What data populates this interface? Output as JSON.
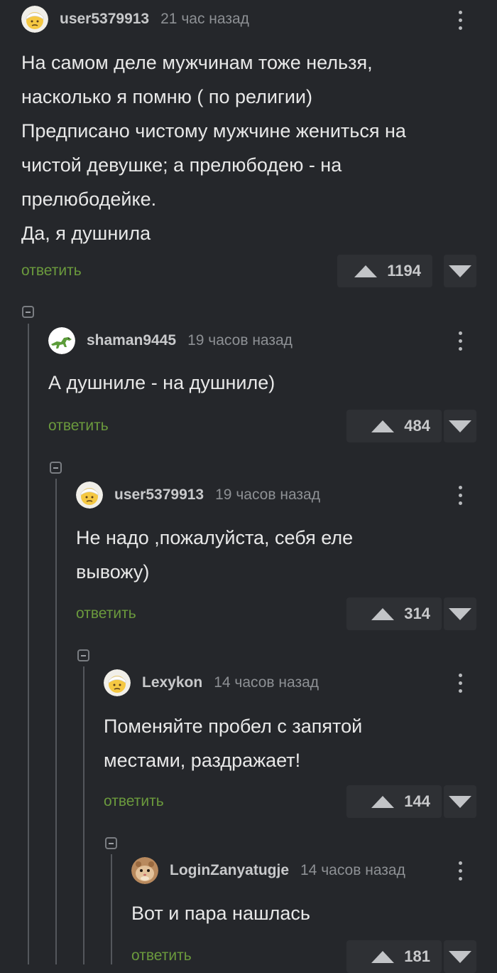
{
  "comments": [
    {
      "username": "user5379913",
      "time": "21 час назад",
      "text": "На самом деле мужчинам тоже нельзя,\nнасколько я помню ( по религии)\nПредписано чистому мужчине жениться на\nчистой девушке; а прелюбодею - на\nпрелюбодейке.\nДа, я душнила",
      "reply_label": "ответить",
      "rating": "1194",
      "avatar_icon": "face-with-head-bandage-emoji"
    },
    {
      "username": "shaman9445",
      "time": "19 часов назад",
      "text": "А душниле - на душниле)",
      "reply_label": "ответить",
      "rating": "484",
      "avatar_icon": "green-dinosaur-avatar"
    },
    {
      "username": "user5379913",
      "time": "19 часов назад",
      "text": "Не надо ,пожалуйста, себя еле\nвывожу)",
      "reply_label": "ответить",
      "rating": "314",
      "avatar_icon": "face-with-head-bandage-emoji"
    },
    {
      "username": "Lexykon",
      "time": "14 часов назад",
      "text": "Поменяйте пробел с запятой\nместами, раздражает!",
      "reply_label": "ответить",
      "rating": "144",
      "avatar_icon": "face-with-head-bandage-emoji"
    },
    {
      "username": "LoginZanyatugje",
      "time": "14 часов назад",
      "text": "Вот и пара нашлась",
      "reply_label": "ответить",
      "rating": "181",
      "avatar_icon": "hamster-photo-avatar"
    }
  ],
  "colors": {
    "background": "#25272b",
    "reply_link": "#6b9a3d",
    "vote_button": "#2e3034",
    "thread_line": "#54575c"
  }
}
